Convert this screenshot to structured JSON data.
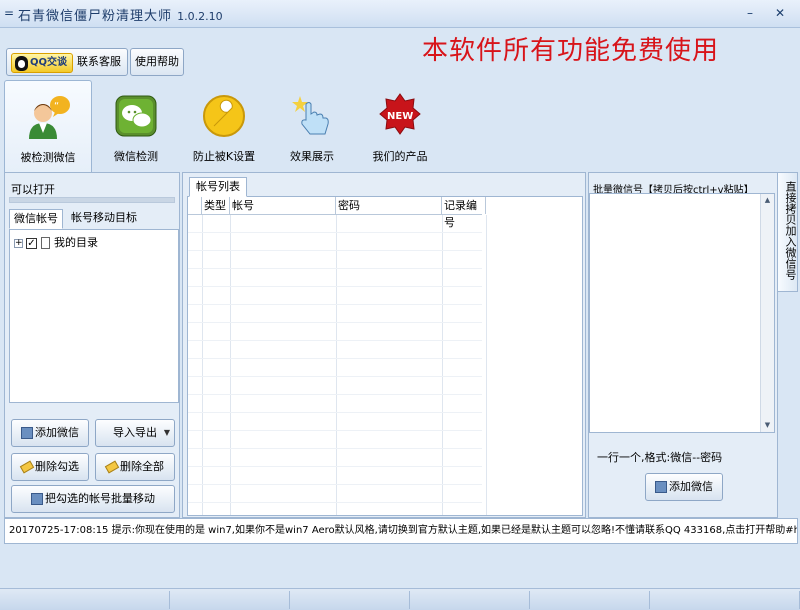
{
  "window": {
    "title": "石青微信僵尸粉清理大师",
    "version": "1.0.2.10",
    "sys_icon": "=",
    "minimize": "–",
    "close": "✕"
  },
  "header": {
    "qq_button": "QQ交谈",
    "contact_service": "联系客服",
    "help": "使用帮助",
    "slogan": "本软件所有功能免费使用"
  },
  "toolbar": [
    {
      "label": "被检测微信",
      "icon": "person-chat-icon"
    },
    {
      "label": "微信检测",
      "icon": "wechat-icon"
    },
    {
      "label": "防止被K设置",
      "icon": "wrench-icon"
    },
    {
      "label": "效果展示",
      "icon": "hand-pointer-icon"
    },
    {
      "label": "我们的产品",
      "icon": "new-badge-icon"
    }
  ],
  "left": {
    "title": "可以打开",
    "tabs": [
      "微信帐号",
      "帐号移动目标"
    ],
    "tree": {
      "expander": "+",
      "check": "✓",
      "label": "我的目录"
    },
    "buttons": {
      "add": "添加微信",
      "import_export": "导入导出",
      "delete_checked": "删除勾选",
      "delete_all": "删除全部",
      "batch_move": "把勾选的帐号批量移动"
    }
  },
  "center": {
    "tab": "帐号列表",
    "columns": [
      "类型",
      "帐号",
      "密码",
      "记录编号"
    ]
  },
  "right": {
    "title": "批量微信号【拷贝后按ctrl+v粘贴】",
    "hint": "一行一个,格式:微信--密码",
    "add_button": "添加微信",
    "side_tab": "直接拷贝加入微信号"
  },
  "status": {
    "message": "20170725-17:08:15  提示:你现在使用的是 win7,如果你不是win7 Aero默认风格,请切换到官方默认主题,如果已经是默认主题可以忽略!不懂请联系QQ 433168,点击打开帮助#http"
  }
}
